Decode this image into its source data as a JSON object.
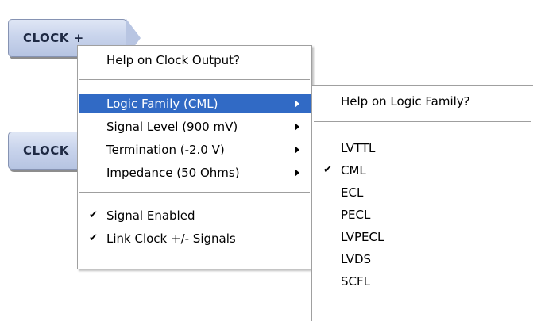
{
  "buttons": {
    "top_label": "CLOCK +",
    "bottom_label": "CLOCK"
  },
  "menu": {
    "help": "Help on Clock Output?",
    "logic_family": "Logic Family (CML)",
    "signal_level": "Signal Level (900 mV)",
    "termination": "Termination (-2.0 V)",
    "impedance": "Impedance (50 Ohms)",
    "signal_enabled": "Signal Enabled",
    "link_clock": "Link Clock +/- Signals",
    "check_glyph": "✔"
  },
  "submenu": {
    "help": "Help on Logic Family?",
    "options": [
      "LVTTL",
      "CML",
      "ECL",
      "PECL",
      "LVPECL",
      "LVDS",
      "SCFL"
    ],
    "selected": "CML"
  },
  "colors": {
    "highlight": "#316ac5",
    "button": "#c9d4ec"
  }
}
